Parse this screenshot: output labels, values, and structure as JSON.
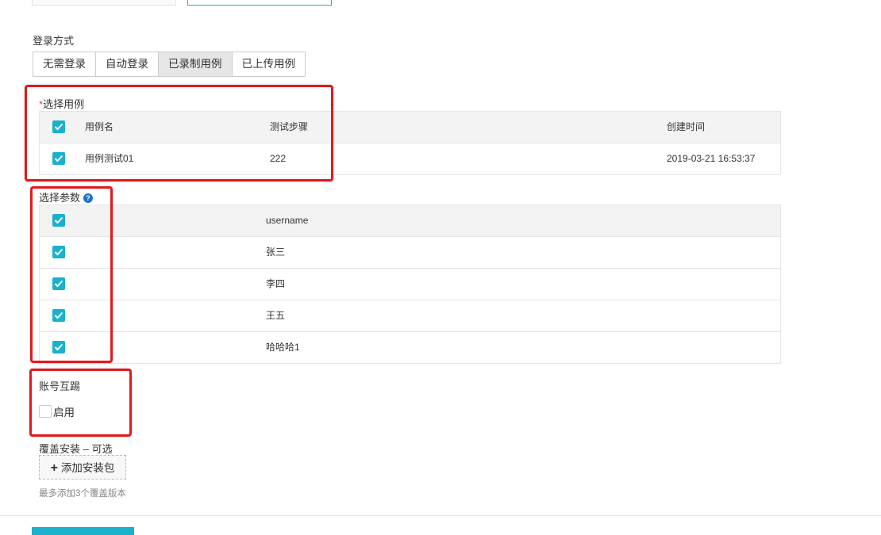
{
  "login_mode": {
    "label": "登录方式",
    "options": [
      "无需登录",
      "自动登录",
      "已录制用例",
      "已上传用例"
    ],
    "selected_index": 2
  },
  "select_case": {
    "required_mark": "*",
    "label": "选择用例",
    "columns": [
      "用例名",
      "测试步骤",
      "创建时间"
    ],
    "header_checked": true,
    "rows": [
      {
        "checked": true,
        "name": "用例测试01",
        "steps": "222",
        "created": "2019-03-21 16:53:37"
      }
    ]
  },
  "select_params": {
    "label": "选择参数",
    "help_icon": "question-circle-icon",
    "column": "username",
    "header_checked": true,
    "rows": [
      {
        "checked": true,
        "value": "张三"
      },
      {
        "checked": true,
        "value": "李四"
      },
      {
        "checked": true,
        "value": "王五"
      },
      {
        "checked": true,
        "value": "哈哈哈1"
      }
    ]
  },
  "account_kick": {
    "label": "账号互踢",
    "checkbox_label": "启用",
    "checked": false
  },
  "overwrite_install": {
    "label": "覆盖安装 – 可选",
    "add_button_label": "添加安装包",
    "add_icon": "plus-icon",
    "hint": "最多添加3个覆盖版本"
  },
  "colors": {
    "accent": "#19b1cc",
    "highlight_box": "#e3191d",
    "required": "#e5403b",
    "help_icon": "#1a73c9"
  }
}
